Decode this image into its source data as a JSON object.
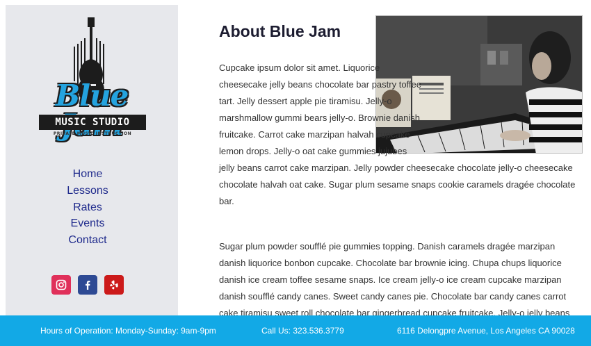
{
  "brand": {
    "name": "Blue Jam",
    "banner": "MUSIC STUDIO",
    "tagline": "PRIVATE MUSIC INSTRUCTION"
  },
  "nav": {
    "items": [
      {
        "label": "Home"
      },
      {
        "label": "Lessons"
      },
      {
        "label": "Rates"
      },
      {
        "label": "Events"
      },
      {
        "label": "Contact"
      }
    ]
  },
  "social": [
    {
      "icon": "instagram-icon",
      "color": "#e0305a"
    },
    {
      "icon": "facebook-icon",
      "color": "#2e4a94"
    },
    {
      "icon": "yelp-icon",
      "color": "#cc1a1a"
    }
  ],
  "main": {
    "title": "About Blue Jam",
    "paragraphs": [
      "Cupcake ipsum dolor sit amet. Liquorice cheesecake jelly beans chocolate bar pastry toffee tart. Jelly dessert apple pie tiramisu. Jelly-o marshmallow gummi bears jelly-o. Brownie danish fruitcake. Carrot cake marzipan halvah cupcake lemon drops. Jelly-o oat cake gummies jujubes jelly beans carrot cake marzipan. Jelly powder cheesecake chocolate jelly-o cheesecake chocolate halvah oat cake. Sugar plum sesame snaps cookie caramels dragée chocolate bar.",
      "Sugar plum powder soufflé pie gummies topping. Danish caramels dragée marzipan danish liquorice bonbon cupcake. Chocolate bar brownie icing. Chupa chups liquorice danish ice cream toffee sesame snaps. Ice cream jelly-o ice cream cupcake marzipan danish soufflé candy canes. Sweet candy canes pie. Chocolate bar candy canes carrot cake tiramisu sweet roll chocolate bar gingerbread cupcake fruitcake. Jelly-o jelly beans marshmallow"
    ]
  },
  "footer": {
    "hours": "Hours of Operation: Monday-Sunday: 9am-9pm",
    "phone": "Call Us: 323.536.3779",
    "address": "6116 Delongpre Avenue, Los Angeles CA 90028"
  },
  "colors": {
    "footer_bg": "#12a9e6",
    "sidebar_bg": "#e7e8ec",
    "nav_link": "#1f2a8c",
    "logo_blue": "#24a3df"
  }
}
